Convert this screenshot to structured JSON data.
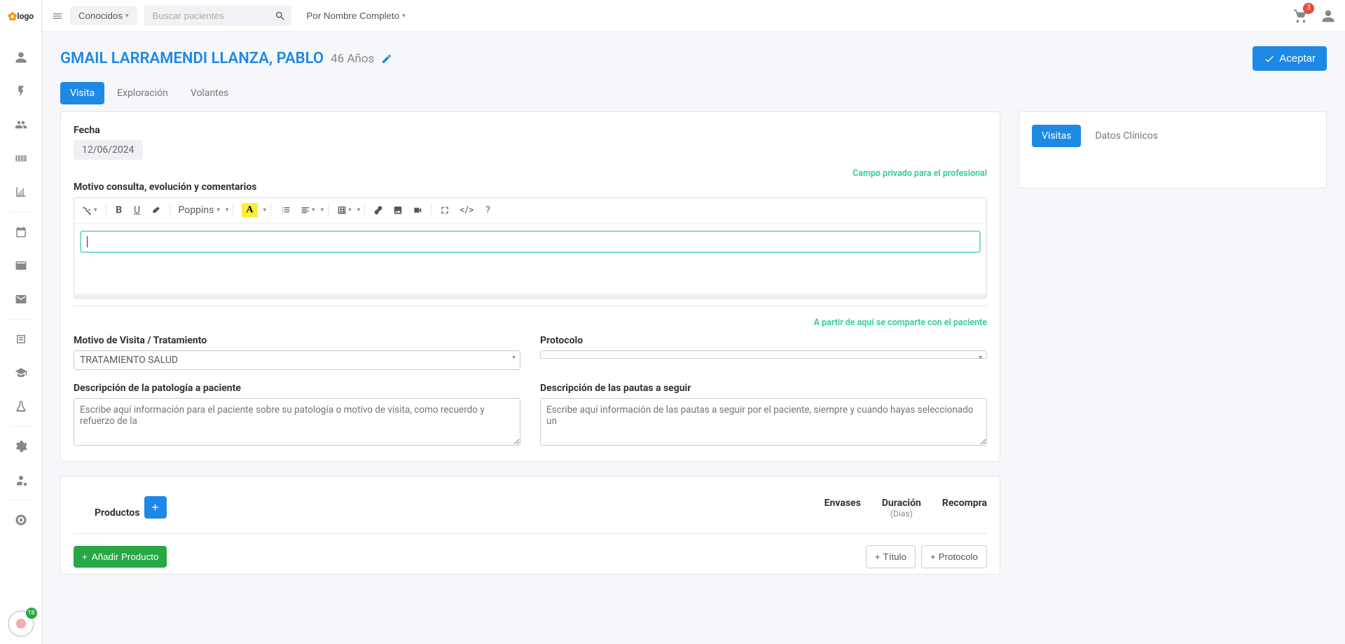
{
  "topbar": {
    "known_filter": "Conocidos",
    "search_placeholder": "Buscar pacientes",
    "sort_label": "Por Nombre Completo",
    "cart_count": "3"
  },
  "sidebar": {
    "rec_badge": "18"
  },
  "patient": {
    "name": "GMAIL LARRAMENDI LLANZA, PABLO",
    "age": "46 Años"
  },
  "buttons": {
    "accept": "Aceptar",
    "add_product": "Añadir Producto",
    "title": "Título",
    "protocol": "Protocolo"
  },
  "tabs": {
    "visita": "Visita",
    "exploracion": "Exploración",
    "volantes": "Volantes",
    "visitas": "Visitas",
    "datos_clinicos": "Datos Clínicos"
  },
  "labels": {
    "fecha": "Fecha",
    "motivo_comentarios": "Motivo consulta, evolución y comentarios",
    "private_note": "Campo privado para el profesional",
    "share_note": "A partir de aquí se comparte con el paciente",
    "motivo_tratamiento": "Motivo de Visita / Tratamiento",
    "protocolo": "Protocolo",
    "desc_patologia": "Descripción de la patología a paciente",
    "desc_pautas": "Descripción de las pautas a seguir",
    "productos": "Productos",
    "envases": "Envases",
    "duracion": "Duración",
    "dias": "(Días)",
    "recompra": "Recompra"
  },
  "values": {
    "fecha": "12/06/2024",
    "motivo_tratamiento": "TRATAMIENTO SALUD",
    "protocolo": "",
    "font_name": "Poppins"
  },
  "placeholders": {
    "desc_patologia": "Escribe aquí información para el paciente sobre su patología o motivo de visita, como recuerdo y refuerzo de la",
    "desc_pautas": "Escribe aquí información de las pautas a seguir por el paciente, siempre y cuando hayas seleccionado un"
  }
}
